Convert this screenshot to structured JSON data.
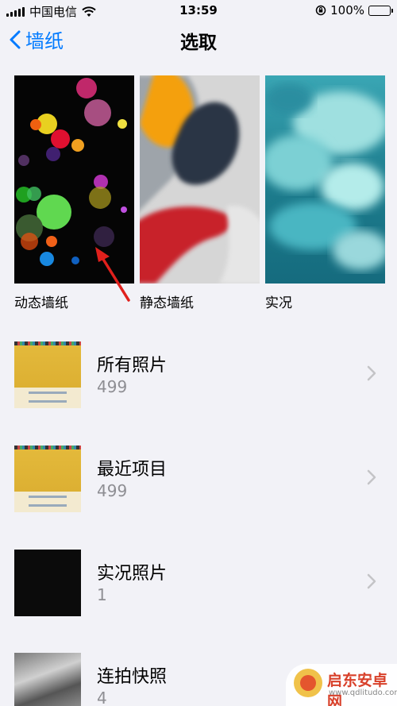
{
  "status_bar": {
    "carrier": "中国电信",
    "time": "13:59",
    "battery": "100%",
    "battery_level": 1.0
  },
  "nav": {
    "back_label": "墙纸",
    "title": "选取"
  },
  "wallpaper_types": [
    {
      "label": "动态墙纸"
    },
    {
      "label": "静态墙纸"
    },
    {
      "label": "实况"
    }
  ],
  "albums": [
    {
      "title": "所有照片",
      "count": "499"
    },
    {
      "title": "最近项目",
      "count": "499"
    },
    {
      "title": "实况照片",
      "count": "1"
    },
    {
      "title": "连拍快照",
      "count": "4"
    }
  ],
  "watermark": {
    "name": "启东安卓网",
    "url": "www.qdlitudo.com"
  },
  "colors": {
    "accent": "#007aff",
    "background": "#f2f2f7",
    "secondary_text": "#8e8e93",
    "annotation_arrow": "#e0201c"
  },
  "icons": {
    "back": "chevron-left-icon",
    "row": "chevron-right-icon",
    "wifi": "wifi-icon",
    "orientation_lock": "orientation-lock-icon"
  }
}
